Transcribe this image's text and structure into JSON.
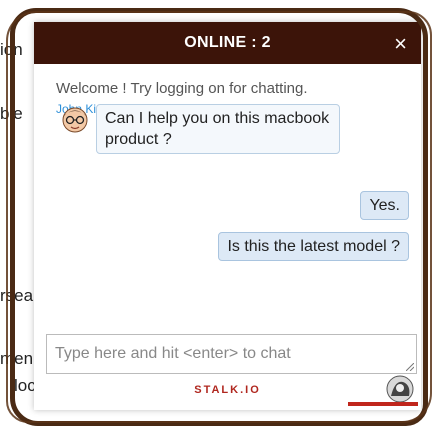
{
  "background_text": [
    "ion",
    "ble",
    "rsea",
    "men",
    "loca"
  ],
  "chat": {
    "header_title": "ONLINE : 2",
    "close_label": "×",
    "welcome": "Welcome ! Try logging on for chatting.",
    "messages": [
      {
        "sender": "John Kim",
        "text": "Can I help you on this macbook product ?"
      },
      {
        "text": "Yes."
      },
      {
        "text": "Is this the latest model ?"
      }
    ],
    "input_placeholder": "Type here and hit <enter> to chat",
    "brand": "STALK.IO"
  }
}
